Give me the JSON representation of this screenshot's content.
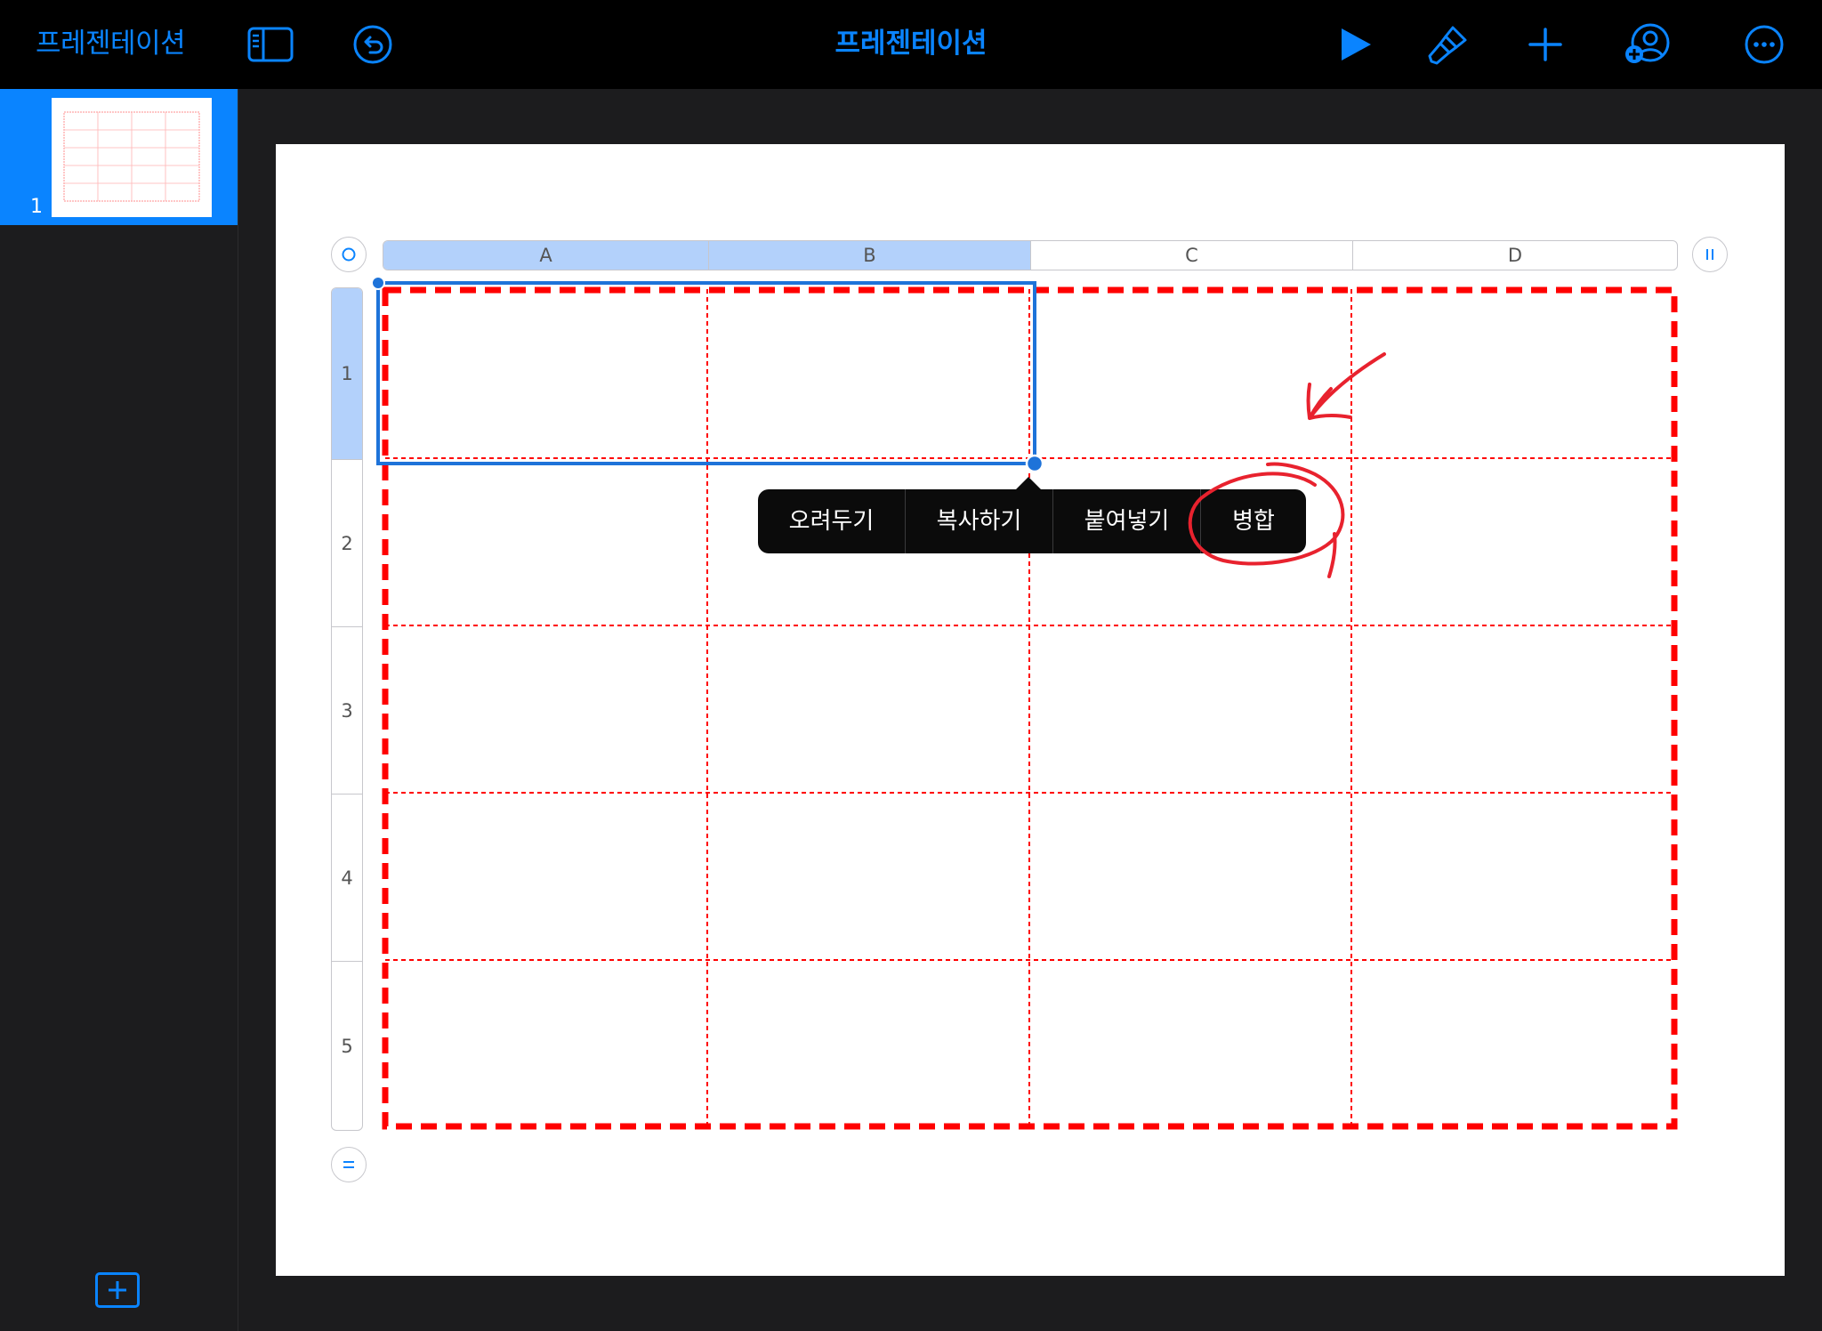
{
  "toolbar": {
    "back_label": "프레젠테이션",
    "title": "프레젠테이션",
    "icons": [
      "sidebar-toggle-icon",
      "undo-icon",
      "play-icon",
      "paintbrush-icon",
      "plus-icon",
      "collaborate-icon",
      "more-icon"
    ]
  },
  "sidebar": {
    "slides": [
      {
        "number": "1"
      }
    ]
  },
  "table": {
    "columns": [
      "A",
      "B",
      "C",
      "D"
    ],
    "rows": [
      "1",
      "2",
      "3",
      "4",
      "5"
    ],
    "selected_columns": [
      "A",
      "B"
    ],
    "selected_rows": [
      "1"
    ]
  },
  "context_menu": {
    "items": [
      "오려두기",
      "복사하기",
      "붙여넣기",
      "병합"
    ]
  },
  "colors": {
    "accent": "#0a84ff",
    "selection": "#b3d1fb",
    "grid_red": "#ff0000",
    "annotation_red": "#e8222e"
  }
}
